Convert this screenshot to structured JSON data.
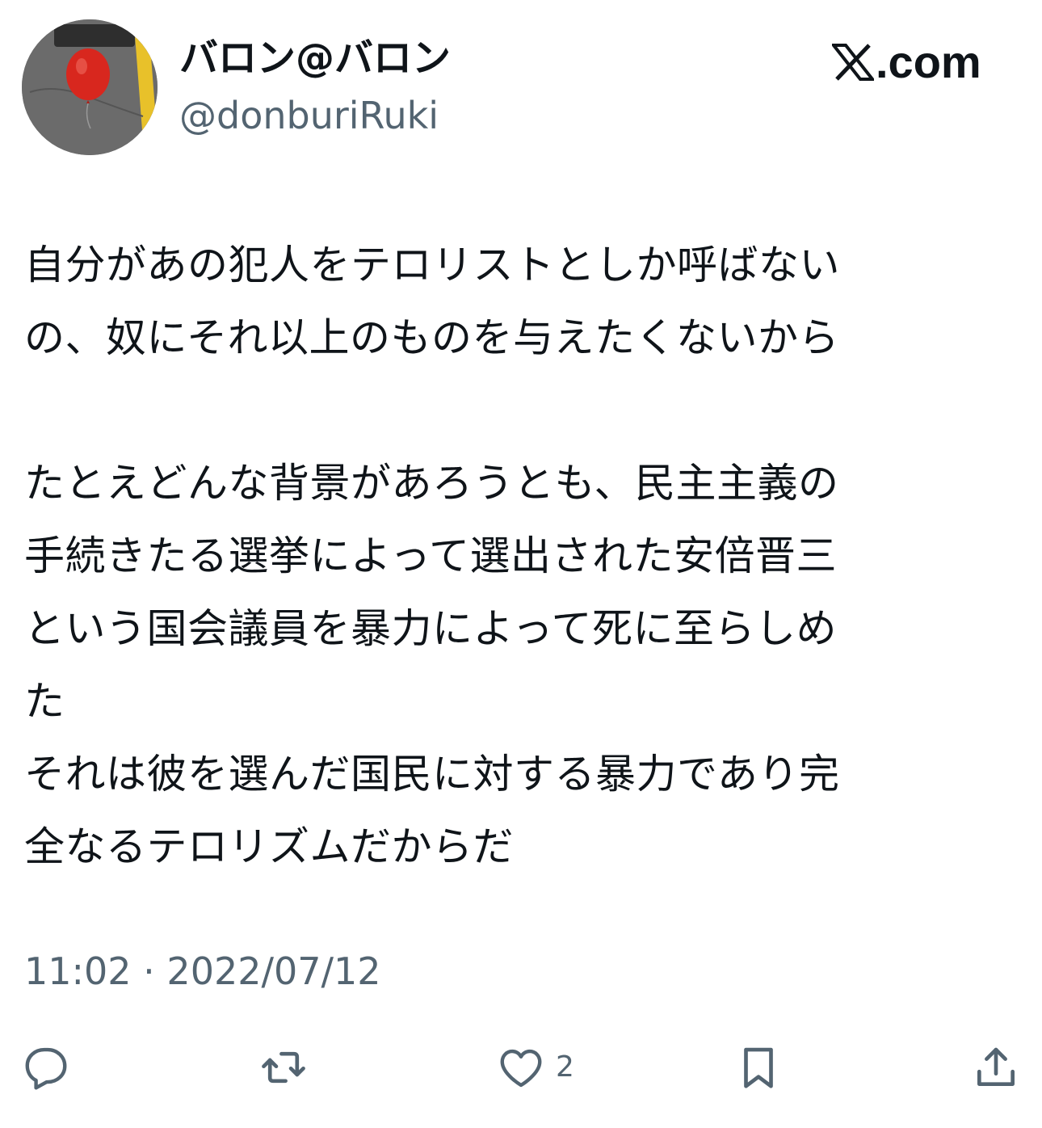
{
  "author": {
    "display_name": "バロン@バロン",
    "handle": "@donburiRuki",
    "avatar_icon": "red-balloon-avatar"
  },
  "brand": {
    "text": ".com",
    "logo_icon": "x-logo-icon"
  },
  "tweet": {
    "lines": [
      "自分があの犯人をテロリストとしか呼ばない",
      "の、奴にそれ以上のものを与えたくないから",
      "",
      "たとえどんな背景があろうとも、民主主義の",
      "手続きたる選挙によって選出された安倍晋三",
      "という国会議員を暴力によって死に至らしめ",
      "た",
      "それは彼を選んだ国民に対する暴力であり完",
      "全なるテロリズムだからだ"
    ]
  },
  "timestamp": "11:02 · 2022/07/12",
  "actions": {
    "reply": {
      "icon": "reply-bubble-icon"
    },
    "repost": {
      "icon": "repost-icon"
    },
    "like": {
      "icon": "heart-icon",
      "count": "2"
    },
    "bookmark": {
      "icon": "bookmark-icon"
    },
    "share": {
      "icon": "share-icon"
    }
  },
  "colors": {
    "text_primary": "#0f1419",
    "text_secondary": "#536471",
    "background": "#ffffff"
  }
}
